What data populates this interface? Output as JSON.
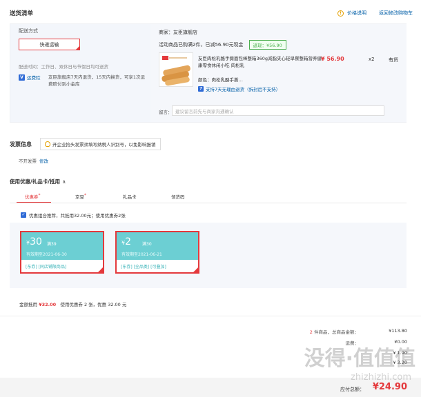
{
  "header": {
    "title": "送货清单",
    "price_note": "价格说明",
    "back_to_cart": "返回修改购物车"
  },
  "delivery": {
    "ship_label": "配送方式",
    "ship_method": "快递运输",
    "ship_time": "配送时间：工作日、双休日与节假日均可送货",
    "svc_badge": "运费险",
    "svc_desc": "友臣旗舰店7天内退货，15天内换货，可享1次运费赔付到小金库"
  },
  "order": {
    "seller": "商家：友臣旗舰店",
    "promo": "活动商品已购满2件，已减56.90元现金",
    "promo_tag": "返现：¥56.90",
    "product_name": "友臣肉松乳酪手撕面包棒整箱360g减脂夹心轻早餐整箱营养健康零食休闲小吃 肉松乳",
    "price": "¥ 56.90",
    "qty": "x2",
    "stock": "有货",
    "color": "颜色：肉松乳酪手撕…",
    "return_policy": "支持7天无理由退货（拆封后不支持）",
    "msg_label": "留言：",
    "msg_placeholder": "建议留言前先与商家沟通确认"
  },
  "invoice": {
    "title": "发票信息",
    "tip": "开企业抬头发票须填写纳税人识别号，以免影响报销",
    "status": "不开发票",
    "edit": "修改"
  },
  "coupons": {
    "title": "使用优惠/礼品卡/抵用",
    "chevron": "∧",
    "tabs": [
      {
        "label": "优惠券",
        "dot": "*"
      },
      {
        "label": "京豆",
        "dot": "*"
      },
      {
        "label": "礼品卡",
        "dot": ""
      },
      {
        "label": "领货码",
        "dot": ""
      }
    ],
    "combo_text": "优惠组合推荐，共抵用32.00元；使用优惠券2张",
    "items": [
      {
        "amount": "30",
        "cond": "满39",
        "expire": "有效期至2021-06-30",
        "tags": "[东券]  [同店铺限商品]"
      },
      {
        "amount": "2",
        "cond": "满30",
        "expire": "有效期至2021-06-21",
        "tags": "[东券]  [全品类]  [可叠加]"
      }
    ],
    "summary_label": "金额抵用",
    "summary_amount": "¥32.00",
    "summary_desc": "使用优惠券 2 张，优惠 32.00 元"
  },
  "totals": {
    "count": "2",
    "count_label": "件商品，总商品金额：",
    "goods_total": "¥113.80",
    "freight_label": "运费：",
    "freight": "¥0.00",
    "row3_value": "¥ 1.90",
    "row4_value": "¥ 3.20",
    "pay_label": "应付总额：",
    "pay_amount": "¥24.90"
  },
  "watermark": {
    "main": "没得·值值值",
    "sub": "zhizhizhi.com"
  }
}
